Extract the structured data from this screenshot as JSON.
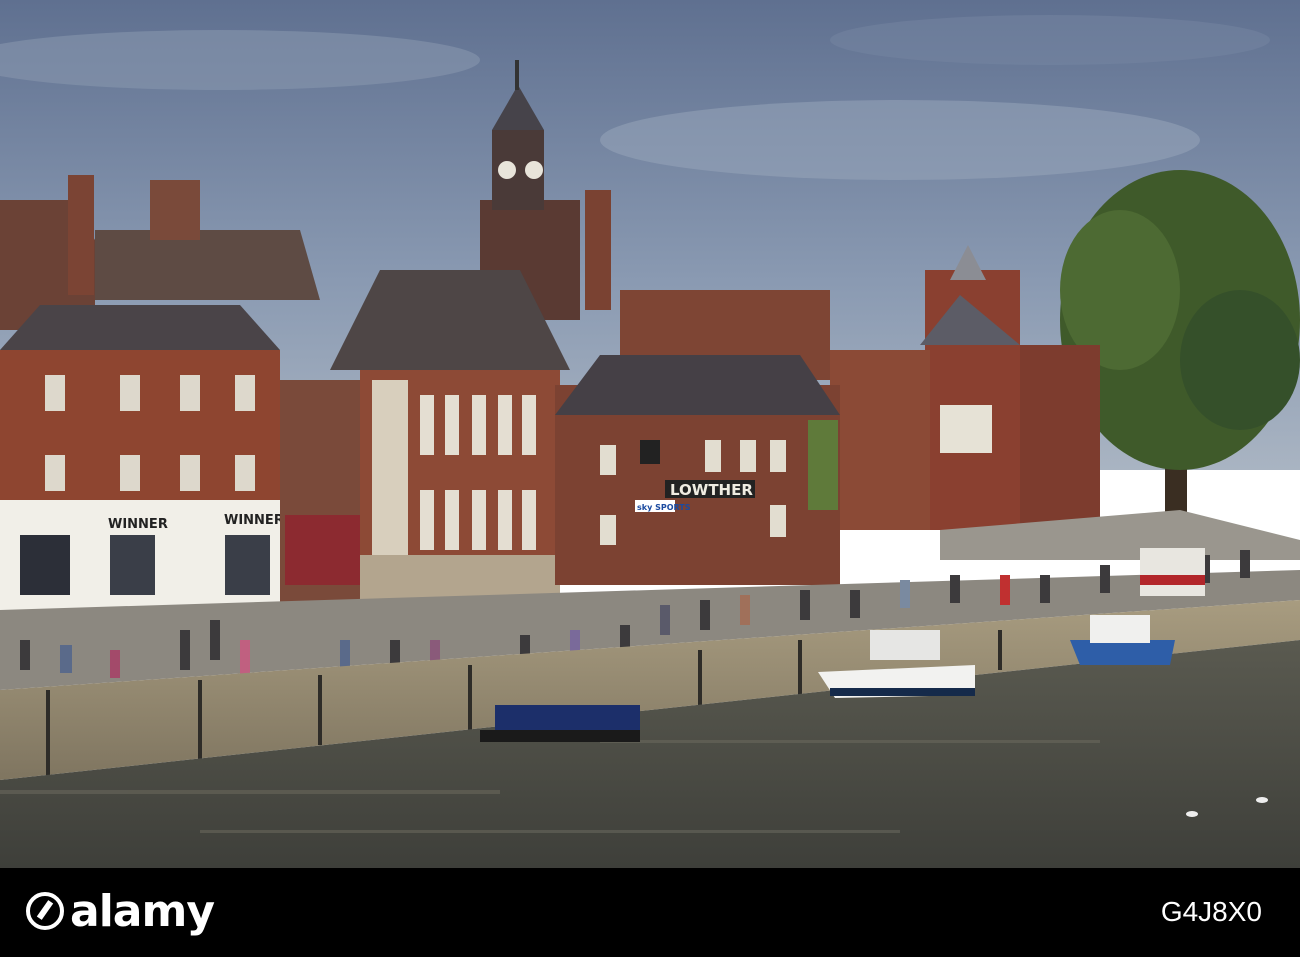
{
  "photo": {
    "description_tags": [
      "river-scene-photo"
    ],
    "signs": {
      "winner_left": "WINNER",
      "winner_right": "WINNER",
      "lowther": "LOWTHER",
      "sky_sports": "sky SPORTS"
    }
  },
  "watermark": {
    "brand": "alamy",
    "image_id": "G4J8X0"
  },
  "colors": {
    "sky": "#7c8ca6",
    "brick": "#8a4a3a",
    "water": "#4a4a42",
    "banner": "#000000"
  }
}
